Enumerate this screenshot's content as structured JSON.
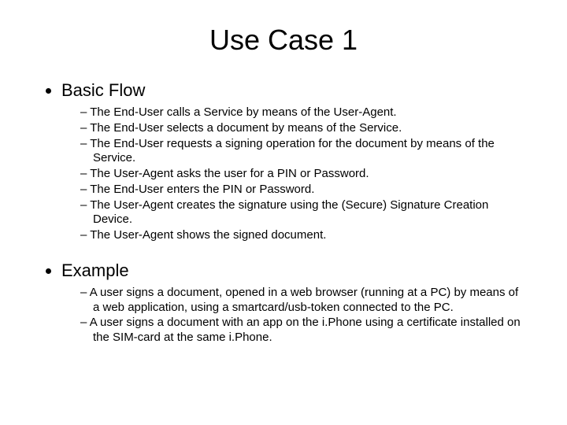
{
  "title": "Use Case 1",
  "sections": [
    {
      "heading": "Basic Flow",
      "items": [
        "The End-User calls a Service by means of the User-Agent.",
        "The End-User selects a document by means of the Service.",
        "The End-User requests a signing operation for the document by means of the Service.",
        "The User-Agent asks the user for a PIN or Password.",
        "The End-User enters the PIN or Password.",
        "The User-Agent creates the signature using the (Secure) Signature Creation Device.",
        "The User-Agent shows the signed document."
      ]
    },
    {
      "heading": "Example",
      "items": [
        "A user signs a document, opened in a web browser (running at a PC) by means of a web application, using a smartcard/usb-token connected to the PC.",
        "A user signs a document with an app on the i.Phone using a certificate installed on the SIM-card at the same i.Phone."
      ]
    }
  ]
}
